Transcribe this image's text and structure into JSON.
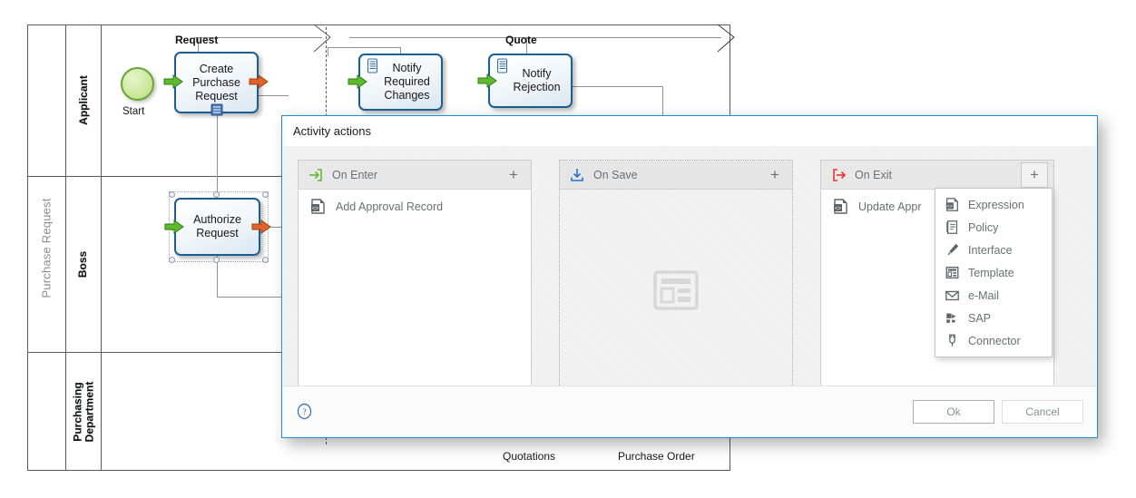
{
  "diagram": {
    "pool_label": "Purchase Request",
    "lanes": [
      {
        "label": "Applicant"
      },
      {
        "label": "Boss"
      },
      {
        "label": "Purchasing\nDepartment"
      }
    ],
    "start_event_label": "Start",
    "tasks": [
      {
        "label": "Create\nPurchase\nRequest",
        "selected": false
      },
      {
        "label": "Notify\nRequired\nChanges",
        "selected": false
      },
      {
        "label": "Notify\nRejection",
        "selected": false
      },
      {
        "label": "Authorize\nRequest",
        "selected": true
      }
    ],
    "flow_labels": [
      "Request",
      "Quote"
    ],
    "bottom_labels": [
      "Quotations",
      "Purchase Order"
    ],
    "colors": {
      "task_border": "#1b5f92",
      "start_border": "#6aa338",
      "green_arrow": "#5fbb2e",
      "orange_arrow": "#e2622a",
      "pool_border": "#5a5a5a"
    }
  },
  "dialog": {
    "title": "Activity actions",
    "panels": [
      {
        "id": "on-enter",
        "title": "On Enter",
        "icon": "enter-arrow-icon",
        "icon_color": "#63b835",
        "style": "solid",
        "add_label": "+",
        "add_active": false,
        "actions": [
          {
            "label": "Add Approval Record",
            "icon": "expression-icon"
          }
        ]
      },
      {
        "id": "on-save",
        "title": "On Save",
        "icon": "save-download-icon",
        "icon_color": "#2f6fd0",
        "style": "dashed",
        "add_label": "+",
        "add_active": false,
        "actions": [],
        "placeholder_icon": "layout-placeholder-icon"
      },
      {
        "id": "on-exit",
        "title": "On Exit",
        "icon": "exit-arrow-icon",
        "icon_color": "#e8342a",
        "style": "solid",
        "add_label": "+",
        "add_active": true,
        "actions": [
          {
            "label": "Update Appr",
            "icon": "expression-icon"
          }
        ]
      }
    ],
    "dropdown": {
      "items": [
        {
          "label": "Expression",
          "icon": "expression-icon"
        },
        {
          "label": "Policy",
          "icon": "policy-icon"
        },
        {
          "label": "Interface",
          "icon": "interface-icon"
        },
        {
          "label": "Template",
          "icon": "template-icon"
        },
        {
          "label": "e-Mail",
          "icon": "email-icon"
        },
        {
          "label": "SAP",
          "icon": "sap-icon"
        },
        {
          "label": "Connector",
          "icon": "connector-icon"
        }
      ]
    },
    "footer": {
      "help_icon": "help-circle-icon",
      "ok_label": "Ok",
      "cancel_label": "Cancel"
    },
    "colors": {
      "border": "#1a8fd4",
      "body_bg": "#f3f3f3",
      "header_bg": "#e8e8e8",
      "text": "#6b6f74"
    }
  }
}
